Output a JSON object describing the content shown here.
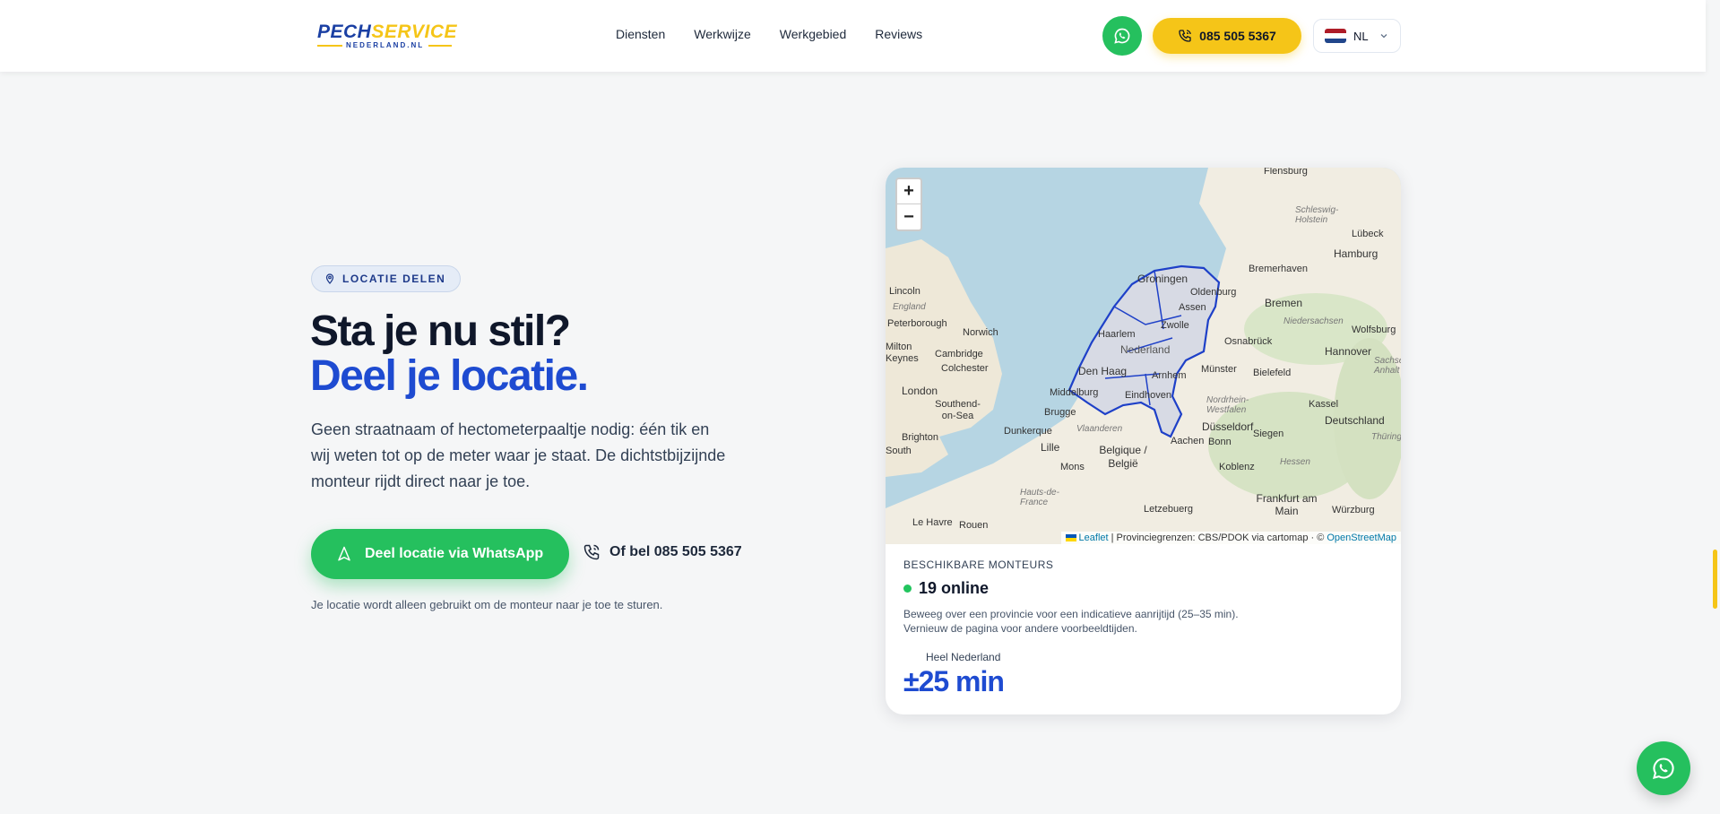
{
  "progress": {
    "percent": 73,
    "color": "#f5c518"
  },
  "header": {
    "logo": {
      "part1": "PECH",
      "part2": "SERVICE",
      "sub": "NEDERLAND.NL"
    },
    "nav": [
      "Diensten",
      "Werkwijze",
      "Werkgebied",
      "Reviews"
    ],
    "whatsapp_icon": "whatsapp-icon",
    "phone_label": "085 505 5367",
    "language": "NL"
  },
  "hero": {
    "badge": "LOCATIE DELEN",
    "title_line1": "Sta je nu stil?",
    "title_line2": "Deel je locatie.",
    "lead": "Geen straatnaam of hectometerpaaltje nodig: één tik en wij weten tot op de meter waar je staat. De dichtstbijzijnde monteur rijdt direct naar je toe.",
    "cta_label": "Deel locatie via WhatsApp",
    "call_label": "Of bel 085 505 5367",
    "note": "Je locatie wordt alleen gebruikt om de monteur naar je toe te sturen."
  },
  "map": {
    "zoom_in": "+",
    "zoom_out": "−",
    "attribution_leaflet": "Leaflet",
    "attribution_text": "| Provinciegrenzen: CBS/PDOK via cartomap · ©",
    "attribution_osm": "OpenStreetMap",
    "labels": [
      "Flensburg",
      "Schleswig-Holstein",
      "Lübeck",
      "Hamburg",
      "Bremerhaven",
      "Groningen",
      "Oldenburg",
      "Bremen",
      "Lincoln",
      "England",
      "Peterborough",
      "Norwich",
      "Milton Keynes",
      "Cambridge",
      "Colchester",
      "London",
      "Southend-on-Sea",
      "Brighton",
      "Haarlem",
      "Den Haag",
      "Middelburg",
      "Brugge",
      "Dunkerque",
      "Lille",
      "Mons",
      "Belgique / België",
      "Arnhem",
      "Eindhoven",
      "Assen",
      "Zwolle",
      "Osnabrück",
      "Hannover",
      "Niedersachsen",
      "Wolfsburg",
      "Bielefeld",
      "Münster",
      "Nordrhein-Westfalen",
      "Düsseldorf",
      "Kassel",
      "Deutschland",
      "Thüringen",
      "Siegen",
      "Aachen",
      "Bonn",
      "Koblenz",
      "Hessen",
      "Frankfurt am Main",
      "Würzburg",
      "Letzebuerg",
      "Hauts-de-France",
      "Le Havre",
      "Rouen",
      "Vlaanderen",
      "Nederland",
      "South",
      "Sachsen-Anhalt"
    ],
    "colors": {
      "sea": "#b6d5e3",
      "land": "#f1ede2",
      "border": "#1e40c8"
    }
  },
  "availability": {
    "label": "BESCHIKBARE MONTEURS",
    "online": "19 online",
    "desc_line1": "Beweeg over een provincie voor een indicatieve aanrijtijd (25–35 min).",
    "desc_line2": "Vernieuw de pagina voor andere voorbeeldtijden.",
    "region": "Heel Nederland",
    "time": "±25 min"
  },
  "colors": {
    "green": "#25c05e",
    "yellow": "#f5c518",
    "blue": "#1e4bd1",
    "navy": "#0f172a"
  }
}
